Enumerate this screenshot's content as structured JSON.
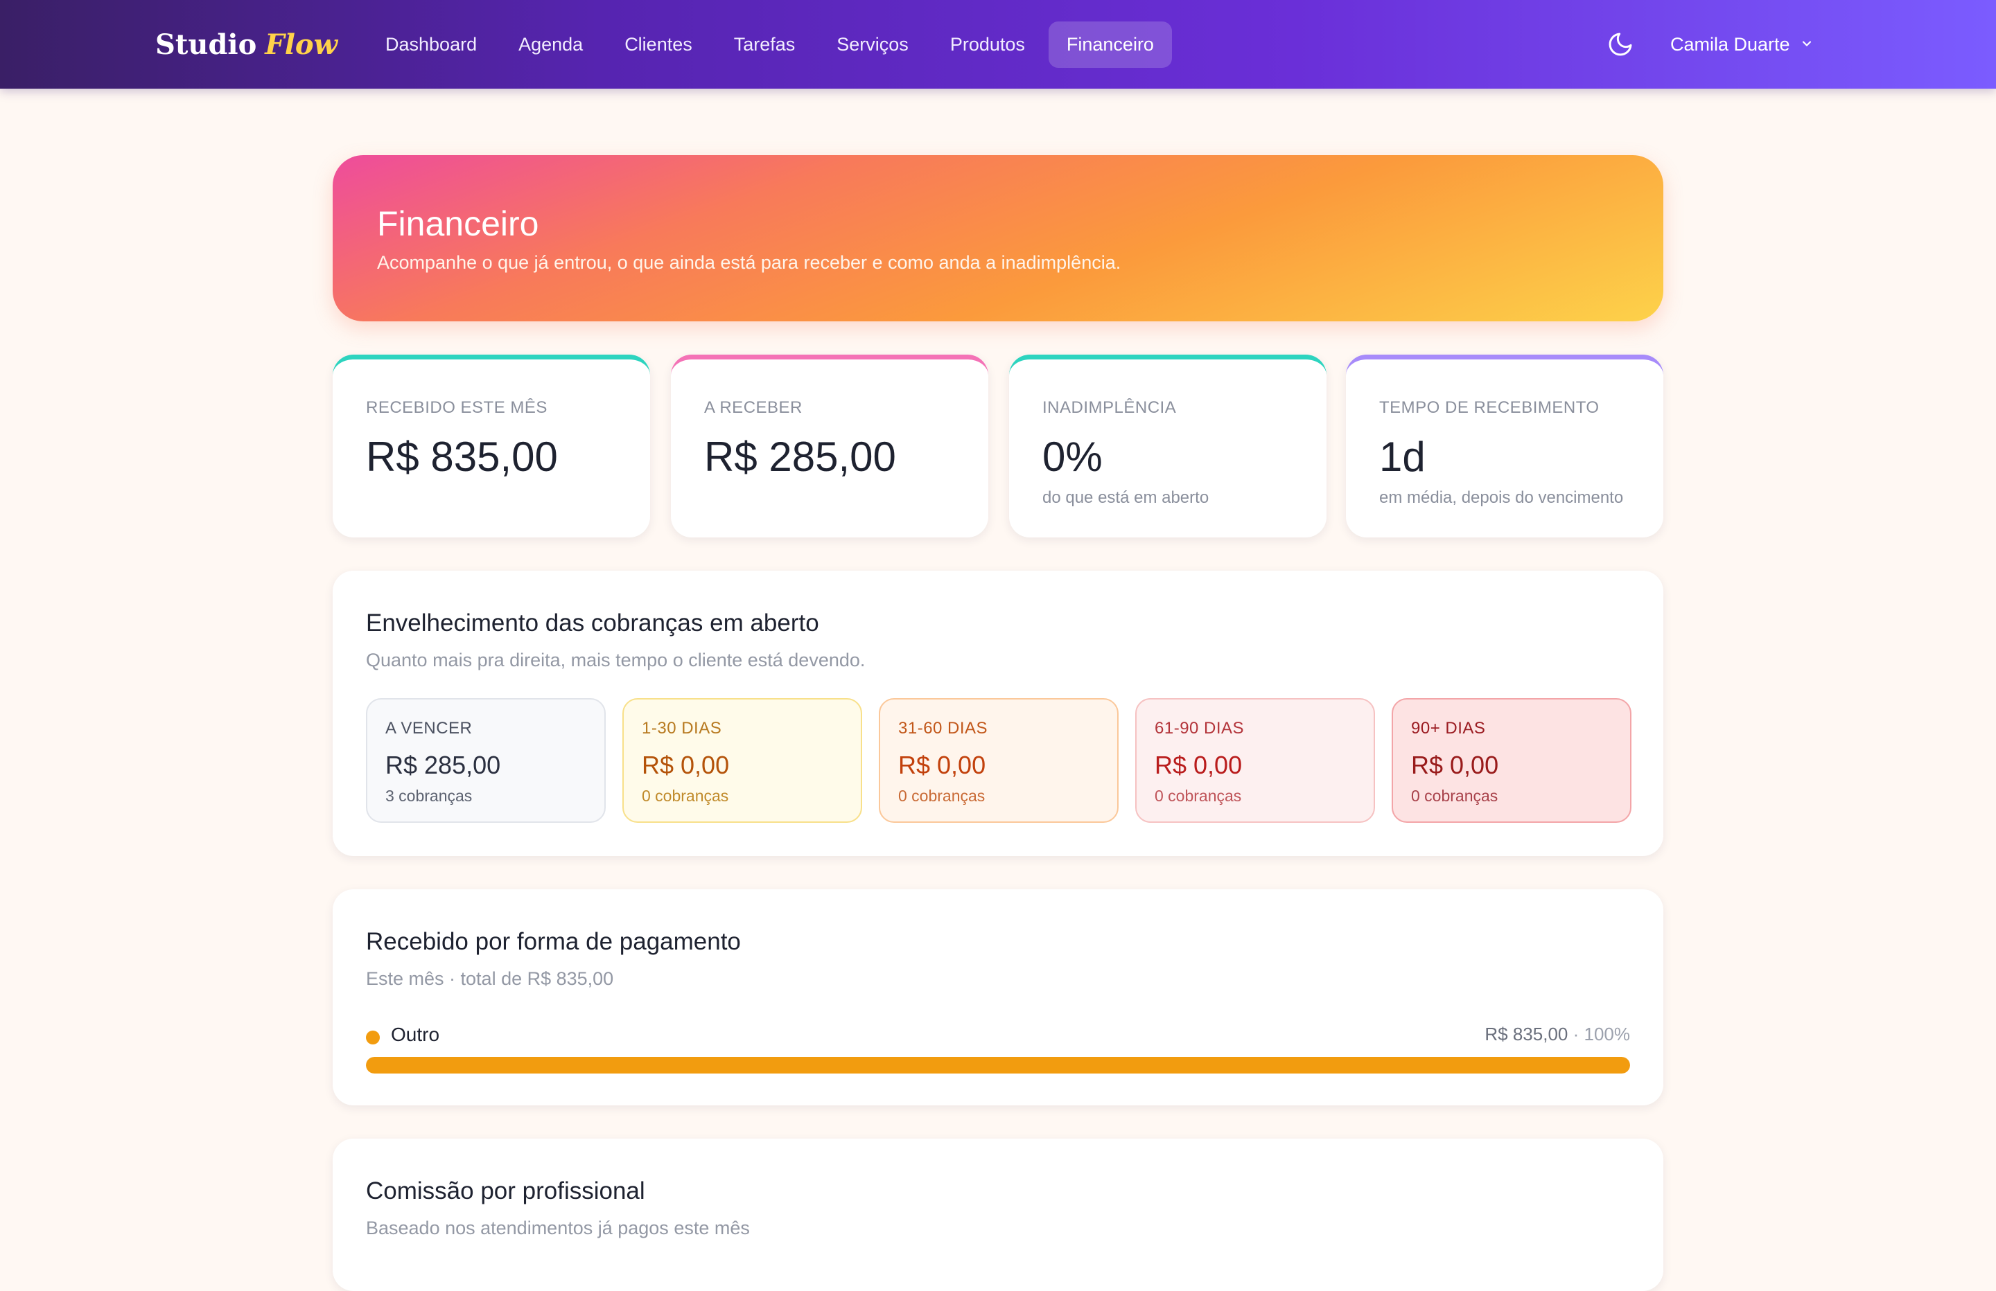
{
  "app": {
    "brand_main": "Studio",
    "brand_accent": "Flow",
    "nav": [
      {
        "label": "Dashboard"
      },
      {
        "label": "Agenda"
      },
      {
        "label": "Clientes"
      },
      {
        "label": "Tarefas"
      },
      {
        "label": "Serviços"
      },
      {
        "label": "Produtos"
      },
      {
        "label": "Financeiro",
        "active": true
      }
    ],
    "theme_toggle_icon": "moon-icon",
    "user_name": "Camila Duarte",
    "user_menu_icon": "chevron-down-icon"
  },
  "hero": {
    "title": "Financeiro",
    "subtitle": "Acompanhe o que já entrou, o que ainda está para receber e como anda a inadimplência."
  },
  "stats": [
    {
      "label": "RECEBIDO ESTE MÊS",
      "value": "R$ 835,00",
      "hint": "",
      "accent": "#2dd4bf"
    },
    {
      "label": "A RECEBER",
      "value": "R$ 285,00",
      "hint": "",
      "accent": "#f472b6"
    },
    {
      "label": "INADIMPLÊNCIA",
      "value": "0%",
      "hint": "do que está em aberto",
      "accent": "#2dd4bf"
    },
    {
      "label": "TEMPO DE RECEBIMENTO",
      "value": "1d",
      "hint": "em média, depois do vencimento",
      "accent": "#a78bfa"
    }
  ],
  "aging": {
    "title": "Envelhecimento das cobranças em aberto",
    "subtitle": "Quanto mais pra direita, mais tempo o cliente está devendo.",
    "buckets": [
      {
        "label": "A VENCER",
        "value": "R$ 285,00",
        "count": "3 cobranças"
      },
      {
        "label": "1-30 DIAS",
        "value": "R$ 0,00",
        "count": "0 cobranças"
      },
      {
        "label": "31-60 DIAS",
        "value": "R$ 0,00",
        "count": "0 cobranças"
      },
      {
        "label": "61-90 DIAS",
        "value": "R$ 0,00",
        "count": "0 cobranças"
      },
      {
        "label": "90+ DIAS",
        "value": "R$ 0,00",
        "count": "0 cobranças"
      }
    ]
  },
  "payments": {
    "title": "Recebido por forma de pagamento",
    "subtitle": "Este mês · total de R$ 835,00",
    "items": [
      {
        "name": "Outro",
        "amount": "R$ 835,00",
        "percent_label": "· 100%",
        "share": 1.0,
        "color": "#f29c0f"
      }
    ]
  },
  "commission": {
    "title": "Comissão por profissional",
    "subtitle": "Baseado nos atendimentos já pagos este mês"
  }
}
